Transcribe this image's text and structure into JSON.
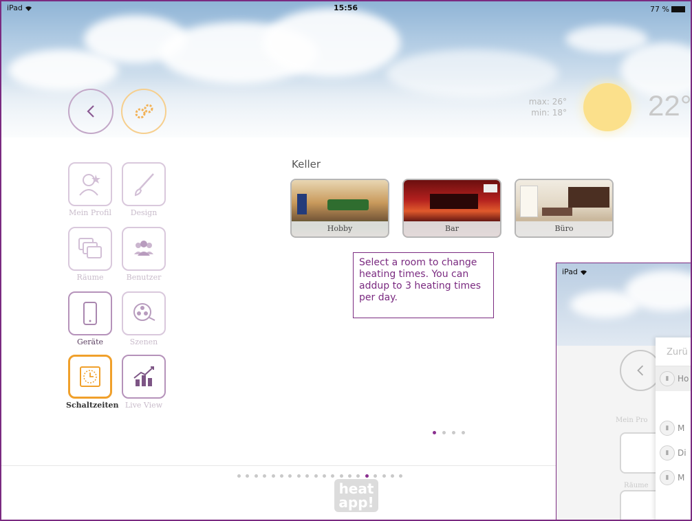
{
  "status_bar": {
    "device": "iPad",
    "time": "15:56",
    "battery": "77 %"
  },
  "weather": {
    "max": "max: 26°",
    "min": "min: 18°",
    "current": "22°"
  },
  "menu": [
    {
      "label": "Mein Profil",
      "icon": "profile-star-icon"
    },
    {
      "label": "Design",
      "icon": "brush-icon"
    },
    {
      "label": "Räume",
      "icon": "rooms-icon"
    },
    {
      "label": "Benutzer",
      "icon": "users-icon"
    },
    {
      "label": "Geräte",
      "icon": "device-icon"
    },
    {
      "label": "Szenen",
      "icon": "film-reel-icon"
    },
    {
      "label": "Schaltzeiten",
      "icon": "clock-icon"
    },
    {
      "label": "Live View",
      "icon": "chart-icon"
    }
  ],
  "rooms_section": {
    "title": "Keller",
    "rooms": [
      {
        "label": "Hobby"
      },
      {
        "label": "Bar"
      },
      {
        "label": "Büro"
      }
    ]
  },
  "tooltip": {
    "text": "Select a room to change heating times. You can addup to 3 heating times per day."
  },
  "room_pager": {
    "count": 4,
    "active": 1
  },
  "page_pager": {
    "count": 20,
    "active": 16
  },
  "logo": {
    "line1": "heat",
    "line2": "app!"
  },
  "inset": {
    "device": "iPad",
    "panel_title": "Zurü",
    "rows": [
      "Ho",
      "M",
      "Di",
      "M"
    ],
    "labels": [
      "Mein Pro",
      "Räume"
    ]
  }
}
